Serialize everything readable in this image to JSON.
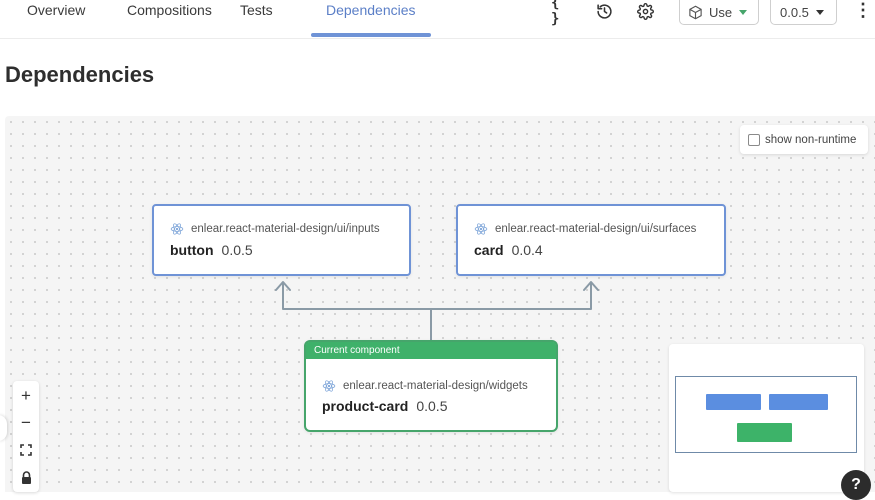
{
  "nav": {
    "tabs": [
      {
        "label": "Overview"
      },
      {
        "label": "Compositions"
      },
      {
        "label": "Tests"
      },
      {
        "label": "Dependencies"
      }
    ],
    "code_icon": "{ }",
    "use_label": "Use",
    "version": "0.0.5"
  },
  "page": {
    "title": "Dependencies"
  },
  "canvas": {
    "toggle_label": "show non-runtime",
    "nodes": [
      {
        "scope": "enlear.react-material-design/ui/inputs",
        "name": "button",
        "version": "0.0.5"
      },
      {
        "scope": "enlear.react-material-design/ui/surfaces",
        "name": "card",
        "version": "0.0.4"
      }
    ],
    "current": {
      "header": "Current component",
      "scope": "enlear.react-material-design/widgets",
      "name": "product-card",
      "version": "0.0.5"
    }
  },
  "controls": {
    "zoom_in": "+",
    "zoom_out": "−"
  },
  "help": {
    "label": "?"
  },
  "colors": {
    "accent": "#6f93d6",
    "current": "#3fb16a",
    "edge": "#8a9aa6",
    "minimap_dependency": "#5b8ee0",
    "minimap_current": "#3db369"
  }
}
